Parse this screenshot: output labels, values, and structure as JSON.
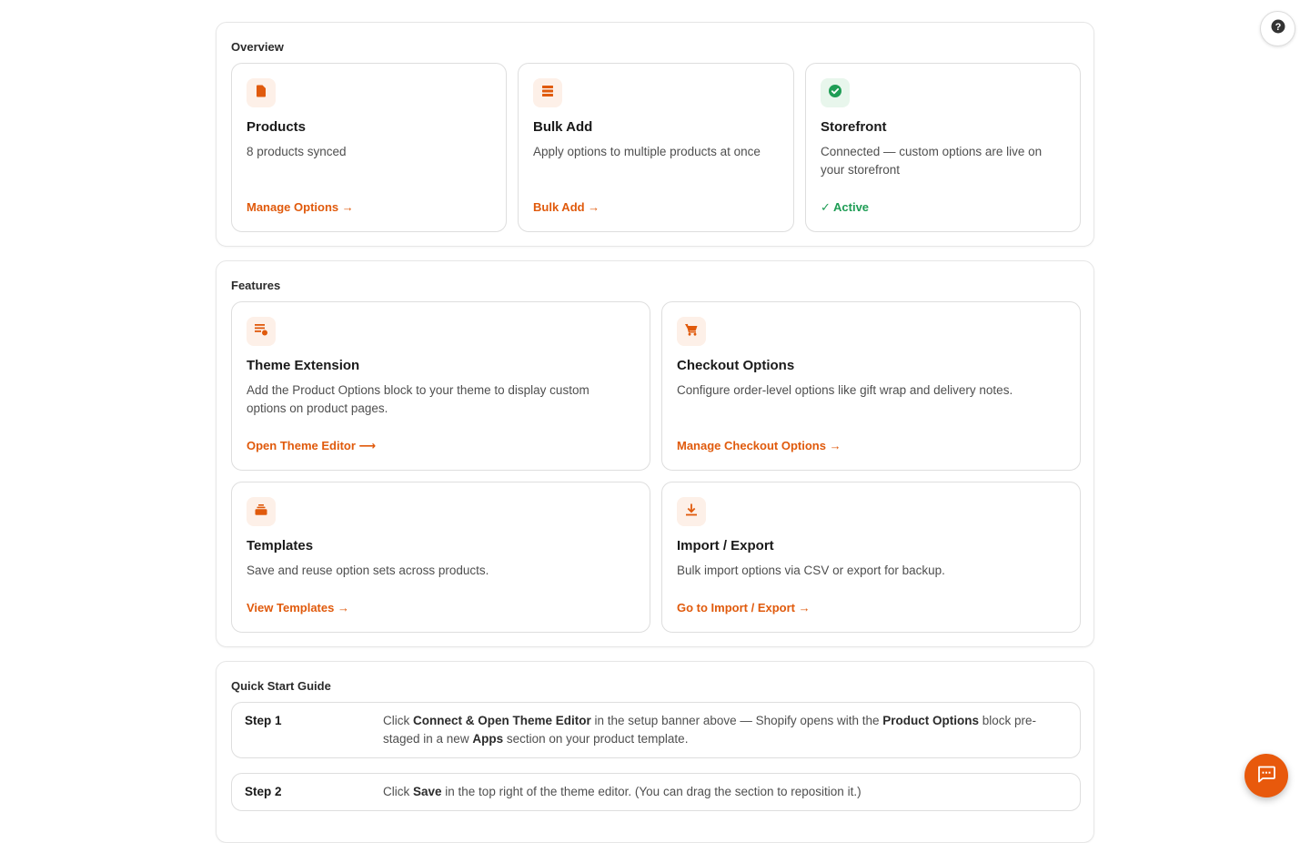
{
  "overview": {
    "title": "Overview",
    "cards": [
      {
        "icon": "file-icon",
        "title": "Products",
        "desc": "8 products synced",
        "link": "Manage Options →"
      },
      {
        "icon": "list-icon",
        "title": "Bulk Add",
        "desc": "Apply options to multiple products at once",
        "link": "Bulk Add →"
      },
      {
        "icon": "check-circle-icon",
        "title": "Storefront",
        "desc": "Connected — custom options are live on your storefront",
        "status": "✓ Active"
      }
    ]
  },
  "features": {
    "title": "Features",
    "cards": [
      {
        "icon": "playlist-add-icon",
        "title": "Theme Extension",
        "desc": "Add the Product Options block to your theme to display custom options on product pages.",
        "link": "Open Theme Editor ⟶"
      },
      {
        "icon": "cart-icon",
        "title": "Checkout Options",
        "desc": "Configure order-level options like gift wrap and delivery notes.",
        "link": "Manage Checkout Options →"
      },
      {
        "icon": "stack-icon",
        "title": "Templates",
        "desc": "Save and reuse option sets across products.",
        "link": "View Templates →"
      },
      {
        "icon": "download-icon",
        "title": "Import / Export",
        "desc": "Bulk import options via CSV or export for backup.",
        "link": "Go to Import / Export →"
      }
    ]
  },
  "quickstart": {
    "title": "Quick Start Guide",
    "steps": [
      {
        "label": "Step 1",
        "t1": "Click ",
        "b1": "Connect & Open Theme Editor",
        "t2": " in the setup banner above — Shopify opens with the ",
        "b2": "Product Options",
        "t3": " block pre-staged in a new ",
        "b3": "Apps",
        "t4": " section on your product template."
      },
      {
        "label": "Step 2",
        "t1": "Click ",
        "b1": "Save",
        "t2": " in the top right of the theme editor. (You can drag the section to reposition it.)"
      }
    ]
  },
  "colors": {
    "accent": "#e05a0c",
    "success": "#1f9d55",
    "icon_bg": "#fdf0e8"
  },
  "floating": {
    "help_icon": "help-icon",
    "chat_icon": "chat-icon"
  }
}
